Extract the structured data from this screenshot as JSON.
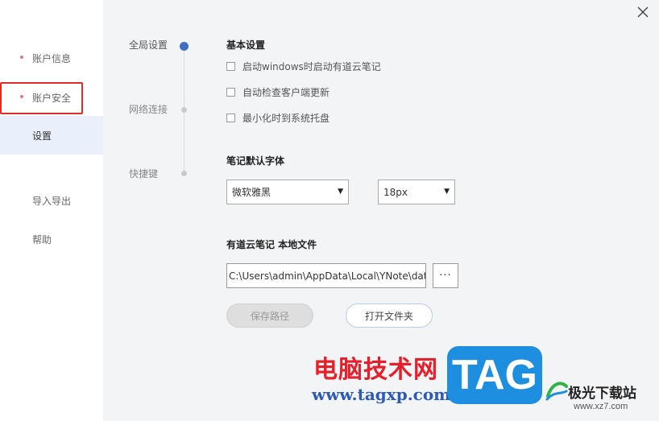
{
  "sidebar": {
    "items": [
      {
        "label": "账户信息"
      },
      {
        "label": "账户安全"
      },
      {
        "label": "设置"
      },
      {
        "label": "导入导出"
      },
      {
        "label": "帮助"
      }
    ]
  },
  "steps": [
    {
      "label": "全局设置"
    },
    {
      "label": "网络连接"
    },
    {
      "label": "快捷键"
    }
  ],
  "basic": {
    "title": "基本设置",
    "options": [
      {
        "label": "启动windows时启动有道云笔记",
        "checked": false
      },
      {
        "label": "自动检查客户端更新",
        "checked": false
      },
      {
        "label": "最小化时到系统托盘",
        "checked": false
      }
    ]
  },
  "font": {
    "title": "笔记默认字体",
    "family": "微软雅黑",
    "size": "18px",
    "arrow": "▼"
  },
  "storage": {
    "title": "有道云笔记  本地文件",
    "path": "C:\\Users\\admin\\AppData\\Local\\YNote\\dat",
    "more_label": "···",
    "save_label": "保存路径",
    "open_label": "打开文件夹"
  },
  "watermark": {
    "cn": "电脑技术网",
    "url": "www.tagxp.com",
    "tag": "TAG",
    "site": "极光下载站",
    "site_url": "www.xz7.com"
  },
  "colors": {
    "accent": "#3e6fc4",
    "highlight_border": "#e02b2b",
    "active_nav_bg": "#e9effb"
  }
}
